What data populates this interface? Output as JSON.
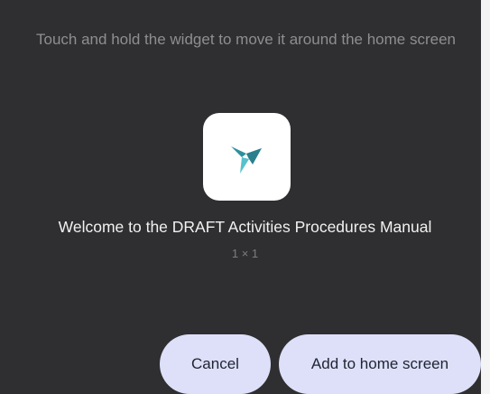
{
  "dialog": {
    "hint": "Touch and hold the widget to move it around the home screen",
    "widget": {
      "title": "Welcome to the DRAFT Activities Procedures Manual",
      "size": "1 × 1",
      "icon": "app-logo-icon"
    },
    "buttons": {
      "cancel_label": "Cancel",
      "add_label": "Add to home screen"
    }
  },
  "colors": {
    "background": "#2f2f31",
    "button": "#dde0f8",
    "accent_teal": "#3aa7b3"
  }
}
